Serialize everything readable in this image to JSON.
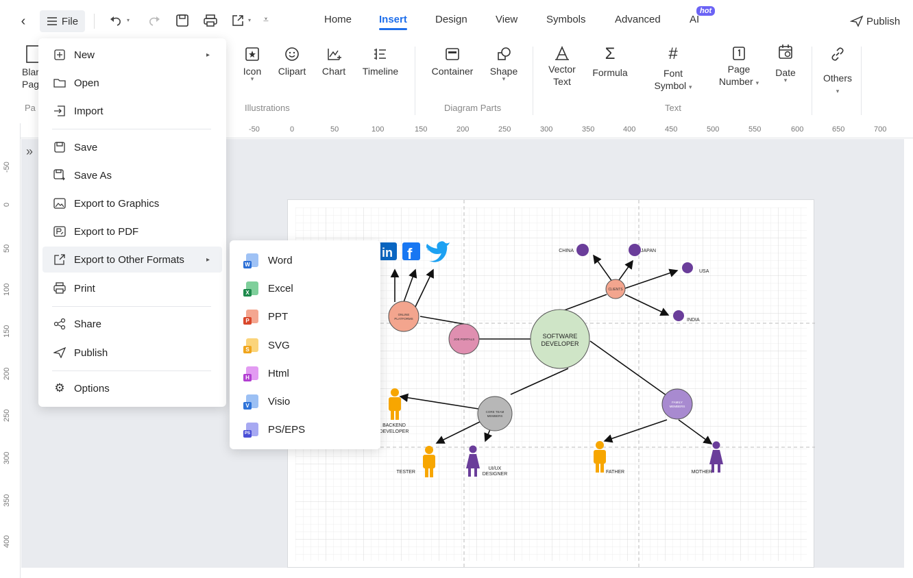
{
  "topbar": {
    "file_label": "File",
    "tabs": [
      "Home",
      "Insert",
      "Design",
      "View",
      "Symbols",
      "Advanced",
      "AI"
    ],
    "active_tab": "Insert",
    "hot_badge": "hot",
    "publish_label": "Publish"
  },
  "ribbon": {
    "blank_page_label_1": "Blar",
    "blank_page_label_2": "Pag",
    "page_group_partial": "Pa",
    "illustrations": [
      "Icon",
      "Clipart",
      "Chart",
      "Timeline"
    ],
    "illustrations_group": "Illustrations",
    "diagram_parts": [
      "Container",
      "Shape"
    ],
    "diagram_parts_group": "Diagram Parts",
    "text_tools": {
      "vector_text_1": "Vector",
      "vector_text_2": "Text",
      "formula": "Formula",
      "font_symbol_1": "Font",
      "font_symbol_2": "Symbol",
      "page_number_1": "Page",
      "page_number_2": "Number",
      "date": "Date"
    },
    "text_group": "Text",
    "others": "Others"
  },
  "ruler": {
    "h_ticks": [
      "-50",
      "0",
      "50",
      "100",
      "150",
      "200",
      "250",
      "300",
      "350",
      "400",
      "450",
      "500",
      "550",
      "600",
      "650",
      "700"
    ],
    "v_ticks": [
      "-50",
      "0",
      "50",
      "100",
      "150",
      "200",
      "250",
      "300",
      "350",
      "400"
    ]
  },
  "file_menu": {
    "items": [
      {
        "label": "New",
        "icon": "plus-square-icon",
        "submenu": true
      },
      {
        "label": "Open",
        "icon": "folder-icon"
      },
      {
        "label": "Import",
        "icon": "import-icon"
      },
      {
        "label": "Save",
        "icon": "save-icon"
      },
      {
        "label": "Save As",
        "icon": "save-as-icon"
      },
      {
        "label": "Export to Graphics",
        "icon": "image-export-icon"
      },
      {
        "label": "Export to PDF",
        "icon": "pdf-export-icon"
      },
      {
        "label": "Export to Other Formats",
        "icon": "export-icon",
        "submenu": true
      },
      {
        "label": "Print",
        "icon": "printer-icon"
      },
      {
        "label": "Share",
        "icon": "share-icon"
      },
      {
        "label": "Publish",
        "icon": "send-icon"
      },
      {
        "label": "Options",
        "icon": "gear-icon"
      }
    ]
  },
  "export_submenu": {
    "items": [
      {
        "label": "Word",
        "letter": "W",
        "color": "#2b6fd6"
      },
      {
        "label": "Excel",
        "letter": "X",
        "color": "#1e8a4c"
      },
      {
        "label": "PPT",
        "letter": "P",
        "color": "#d9472b"
      },
      {
        "label": "SVG",
        "letter": "S",
        "color": "#f0a51c"
      },
      {
        "label": "Html",
        "letter": "H",
        "color": "#b23fd1"
      },
      {
        "label": "Visio",
        "letter": "V",
        "color": "#2f74d9"
      },
      {
        "label": "PS/EPS",
        "letter": "PS",
        "color": "#4a4fd6"
      }
    ]
  },
  "diagram": {
    "software_developer_1": "SOFTWARE",
    "software_developer_2": "DEVELOPER",
    "clients": "CLIENTS",
    "china": "CHINA",
    "japan": "JAPAN",
    "usa": "USA",
    "india": "INDIA",
    "online_platforms_1": "ONLINE",
    "online_platforms_2": "PLATFORMS",
    "job_portals": "JOB PORTALS",
    "core_team_1": "CORE TEAM",
    "core_team_2": "MEMBERS",
    "family_1": "FAMILY",
    "family_2": "MEMBERS",
    "backend_1": "BACKEND",
    "backend_2": "DEVELOPER",
    "tester": "TESTER",
    "uiux_1": "UI/UX",
    "uiux_2": "DESIGNER",
    "father": "FATHER",
    "mother": "MOTHER"
  },
  "colors": {
    "accent": "#1f6feb",
    "software_developer": "#cfe5c7",
    "clients": "#f3a58e",
    "country_dot": "#6a3d9a",
    "online_platforms": "#f3a58e",
    "job_portals": "#df8fb0",
    "core_team": "#b7b7b7",
    "family": "#a88ad0",
    "person_orange": "#f7a600",
    "person_purple": "#6a3d9a"
  }
}
